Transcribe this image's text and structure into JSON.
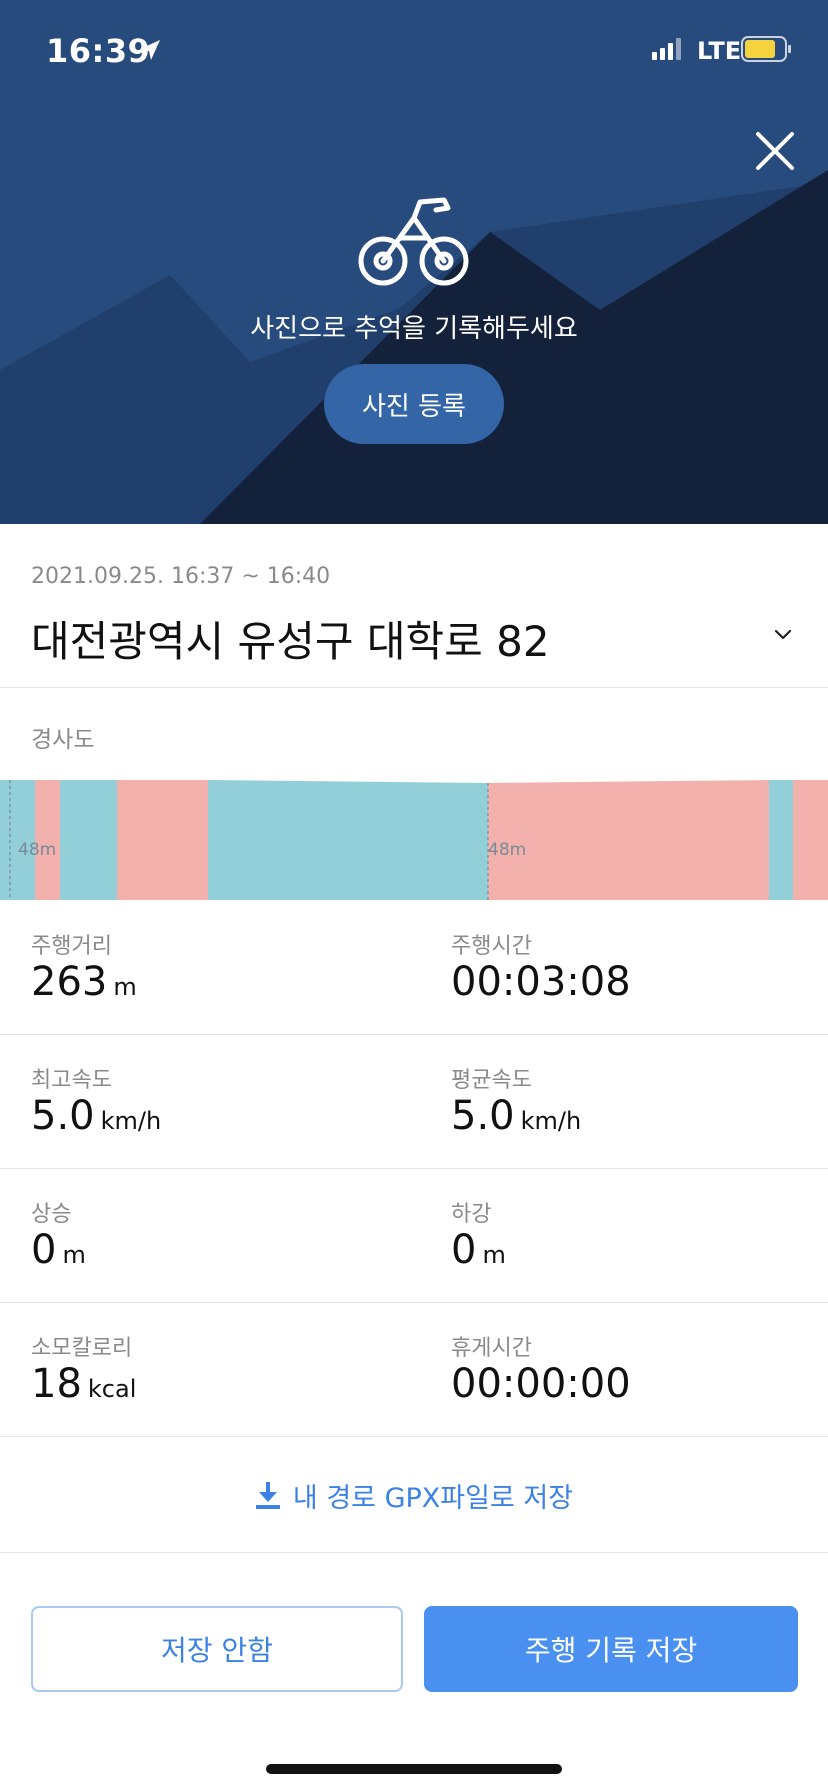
{
  "status_bar": {
    "time": "16:39",
    "network": "LTE",
    "icons": [
      "location-arrow-icon",
      "signal-bars-icon",
      "battery-icon"
    ]
  },
  "hero": {
    "message": "사진으로 추억을 기록해두세요",
    "photo_button": "사진 등록",
    "icons": [
      "bicycle-icon",
      "close-icon"
    ],
    "colors": {
      "sky": "#284b7d",
      "mountain_mid": "#1f3d66",
      "mountain_dark": "#13223a",
      "button": "#3465a6"
    }
  },
  "ride": {
    "datetime": "2021.09.25. 16:37 ~ 16:40",
    "address": "대전광역시 유성구 대학로 82"
  },
  "slope": {
    "label": "경사도",
    "colors": {
      "downhill": "#93cfd9",
      "uphill": "#f2b1ac"
    },
    "markers": [
      "48m",
      "48m"
    ]
  },
  "stats": [
    {
      "label": "주행거리",
      "value": "263",
      "unit": "m"
    },
    {
      "label": "주행시간",
      "value": "00:03:08",
      "unit": ""
    },
    {
      "label": "최고속도",
      "value": "5.0",
      "unit": "km/h"
    },
    {
      "label": "평균속도",
      "value": "5.0",
      "unit": "km/h"
    },
    {
      "label": "상승",
      "value": "0",
      "unit": "m"
    },
    {
      "label": "하강",
      "value": "0",
      "unit": "m"
    },
    {
      "label": "소모칼로리",
      "value": "18",
      "unit": "kcal"
    },
    {
      "label": "휴게시간",
      "value": "00:00:00",
      "unit": ""
    }
  ],
  "gpx_link": "내 경로 GPX파일로 저장",
  "buttons": {
    "discard": "저장 안함",
    "save": "주행 기록 저장"
  },
  "accent": "#4a90f0"
}
